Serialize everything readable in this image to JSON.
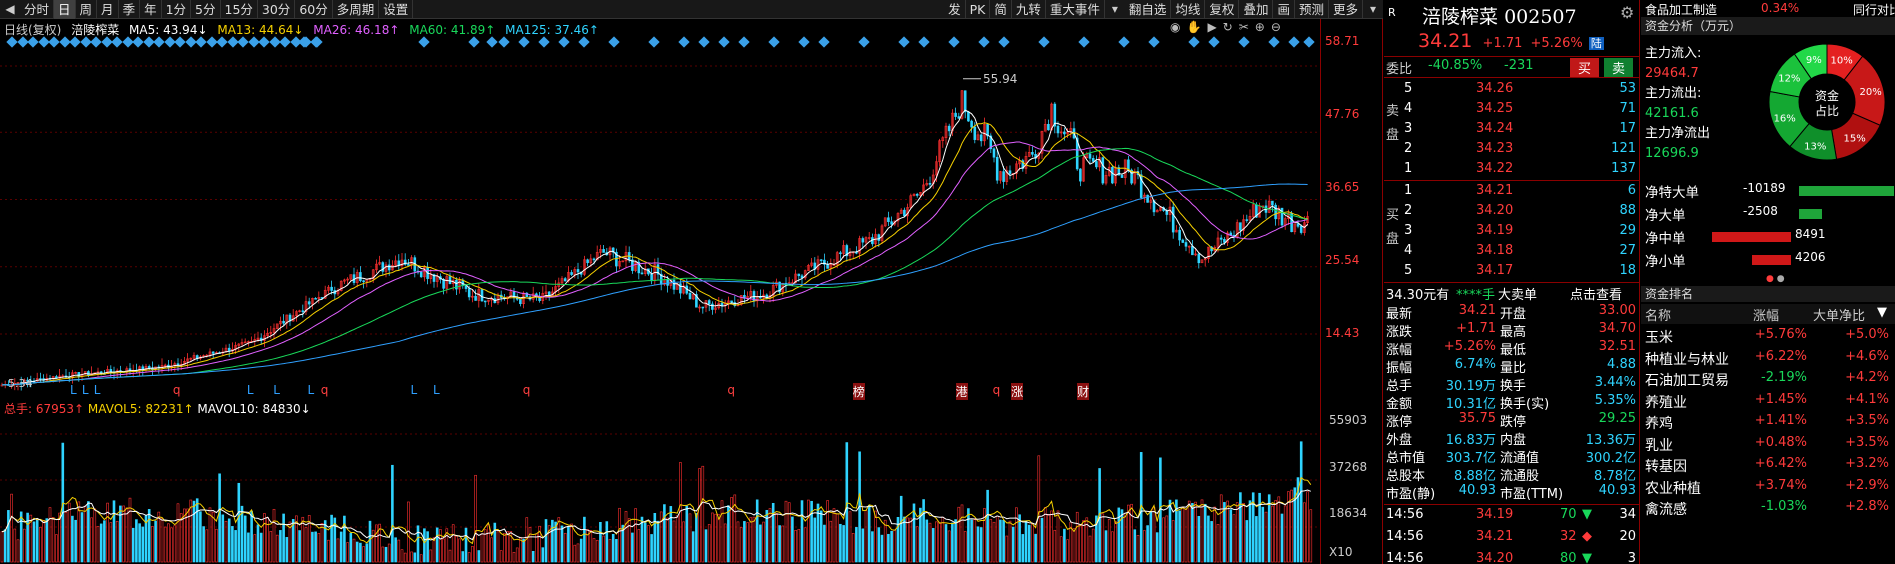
{
  "toolbar": {
    "items": [
      "分时",
      "日",
      "周",
      "月",
      "季",
      "年",
      "1分",
      "5分",
      "15分",
      "30分",
      "60分",
      "多周期",
      "设置"
    ],
    "active": "日",
    "right_items": [
      "发",
      "PK",
      "简",
      "九转",
      "重大事件"
    ],
    "right_items2": [
      "翻自选",
      "均线",
      "复权",
      "叠加",
      "画",
      "预测",
      "更多"
    ]
  },
  "ma": {
    "title": "日线(复权)",
    "name": "涪陵榨菜",
    "ma5": "MA5: 43.94↓",
    "ma13": "MA13: 44.64↓",
    "ma26": "MA26: 46.18↑",
    "ma60": "MA60: 41.89↑",
    "ma125": "MA125: 37.46↑"
  },
  "price_scale": [
    "58.71",
    "47.76",
    "36.65",
    "25.54",
    "14.43"
  ],
  "price_scale_pos": [
    0,
    1,
    2,
    3,
    4
  ],
  "max_label": "55.94",
  "min_label": "5.34",
  "vol_scale": [
    "55903",
    "37268",
    "18634",
    "X10"
  ],
  "vol_legend": {
    "total": "总手: 67953↑",
    "mavol5": "MAVOL5: 82231↑",
    "mavol10": "MAVOL10: 84830↓"
  },
  "signal_letters": [
    {
      "t": "L",
      "x": 0.053
    },
    {
      "t": "L",
      "x": 0.062
    },
    {
      "t": "L",
      "x": 0.071
    },
    {
      "t": "q",
      "x": 0.131
    },
    {
      "t": "L",
      "x": 0.187
    },
    {
      "t": "L",
      "x": 0.207
    },
    {
      "t": "L",
      "x": 0.233
    },
    {
      "t": "q",
      "x": 0.243
    },
    {
      "t": "L",
      "x": 0.311
    },
    {
      "t": "L",
      "x": 0.328
    },
    {
      "t": "q",
      "x": 0.396
    },
    {
      "t": "q",
      "x": 0.551
    },
    {
      "t": "榜",
      "x": 0.646
    },
    {
      "t": "港",
      "x": 0.724
    },
    {
      "t": "q",
      "x": 0.752
    },
    {
      "t": "涨",
      "x": 0.766
    },
    {
      "t": "财",
      "x": 0.816
    }
  ],
  "chart_data": {
    "type": "candlestick",
    "ylim": [
      5.34,
      58.71
    ],
    "max": 55.94
  },
  "quote": {
    "name": "涪陵榨菜",
    "code": "002507",
    "price": "34.21",
    "change": "+1.71",
    "pct": "+5.26%",
    "tag": "陆",
    "r_badge": "R",
    "weibi_label": "委比",
    "weibi": "-40.85%",
    "weicha": "-231",
    "buy_btn": "买",
    "sell_btn": "卖",
    "sell_label": [
      "卖",
      "盘"
    ],
    "buy_label": [
      "买",
      "盘"
    ],
    "asks": [
      {
        "n": "5",
        "p": "34.26",
        "v": "53"
      },
      {
        "n": "4",
        "p": "34.25",
        "v": "71"
      },
      {
        "n": "3",
        "p": "34.24",
        "v": "17"
      },
      {
        "n": "2",
        "p": "34.23",
        "v": "121"
      },
      {
        "n": "1",
        "p": "34.22",
        "v": "137"
      }
    ],
    "bids": [
      {
        "n": "1",
        "p": "34.21",
        "v": "6"
      },
      {
        "n": "2",
        "p": "34.20",
        "v": "88"
      },
      {
        "n": "3",
        "p": "34.19",
        "v": "29"
      },
      {
        "n": "4",
        "p": "34.18",
        "v": "27"
      },
      {
        "n": "5",
        "p": "34.17",
        "v": "18"
      }
    ],
    "bigorder": {
      "price": "34.30元有",
      "stars": "****手",
      "label": "大卖单",
      "link": "点击查看"
    },
    "stats": [
      [
        "最新",
        "34.21",
        "开盘",
        "33.00"
      ],
      [
        "涨跌",
        "+1.71",
        "最高",
        "34.70"
      ],
      [
        "涨幅",
        "+5.26%",
        "最低",
        "32.51"
      ],
      [
        "振幅",
        "6.74%",
        "量比",
        "4.88"
      ],
      [
        "总手",
        "30.19万",
        "换手",
        "3.44%"
      ],
      [
        "金额",
        "10.31亿",
        "换手(实)",
        "5.35%"
      ],
      [
        "涨停",
        "35.75",
        "跌停",
        "29.25"
      ],
      [
        "外盘",
        "16.83万",
        "内盘",
        "13.36万"
      ],
      [
        "总市值",
        "303.7亿",
        "流通值",
        "300.2亿"
      ],
      [
        "总股本",
        "8.88亿",
        "流通股",
        "8.78亿"
      ],
      [
        "市盈(静)",
        "40.93",
        "市盈(TTM)",
        "40.93"
      ]
    ],
    "ticks": [
      {
        "t": "14:56",
        "p": "34.19",
        "v": "70",
        "d": "down",
        "n": "34"
      },
      {
        "t": "14:56",
        "p": "34.21",
        "v": "32",
        "d": "up",
        "n": "20"
      },
      {
        "t": "14:56",
        "p": "34.20",
        "v": "80",
        "d": "down",
        "n": "3"
      }
    ]
  },
  "fund": {
    "sector": "食品加工制造",
    "sector_pct": "0.34%",
    "peer": "同行对比",
    "title": "资金分析（万元）",
    "inflow_label": "主力流入:",
    "inflow": "29464.7",
    "outflow_label": "主力流出:",
    "outflow": "42161.6",
    "net_label": "主力净流出",
    "net": "12696.9",
    "donut_center": [
      "资金",
      "占比"
    ],
    "donut": [
      {
        "pct": "10%",
        "v": 10,
        "c": "#e42020"
      },
      {
        "pct": "20%",
        "v": 20,
        "c": "#c81818"
      },
      {
        "pct": "15%",
        "v": 15,
        "c": "#b01010"
      },
      {
        "pct": "13%",
        "v": 13,
        "c": "#0f8f2a"
      },
      {
        "pct": "16%",
        "v": 16,
        "c": "#14a832"
      },
      {
        "pct": "12%",
        "v": 12,
        "c": "#1bc23c"
      },
      {
        "pct": "9%",
        "v": 9,
        "c": "#22d848"
      }
    ],
    "flows": [
      {
        "label": "净特大单",
        "v": "-10189",
        "n": -10189
      },
      {
        "label": "净大单",
        "v": "-2508",
        "n": -2508
      },
      {
        "label": "净中单",
        "v": "8491",
        "n": 8491
      },
      {
        "label": "净小单",
        "v": "4206",
        "n": 4206
      }
    ],
    "rank_title": "资金排名",
    "rank_tab": "排名",
    "rank_head": [
      "名称",
      "涨幅",
      "大单净比"
    ],
    "rank": [
      [
        "玉米",
        "+5.76%",
        "+5.0%"
      ],
      [
        "种植业与林业",
        "+6.22%",
        "+4.6%"
      ],
      [
        "石油加工贸易",
        "-2.19%",
        "+4.2%"
      ],
      [
        "养殖业",
        "+1.45%",
        "+4.1%"
      ],
      [
        "养鸡",
        "+1.41%",
        "+3.5%"
      ],
      [
        "乳业",
        "+0.48%",
        "+3.5%"
      ],
      [
        "转基因",
        "+6.42%",
        "+3.2%"
      ],
      [
        "农业种植",
        "+3.74%",
        "+2.9%"
      ],
      [
        "禽流感",
        "-1.03%",
        "+2.8%"
      ]
    ]
  }
}
